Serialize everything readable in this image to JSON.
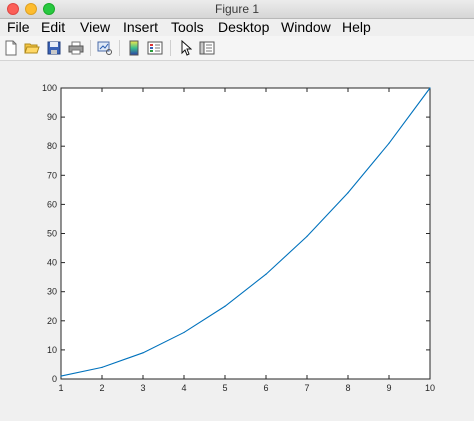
{
  "window": {
    "title": "Figure 1"
  },
  "menu": {
    "file": "File",
    "edit": "Edit",
    "view": "View",
    "insert": "Insert",
    "tools": "Tools",
    "desktop": "Desktop",
    "window": "Window",
    "help": "Help"
  },
  "toolbar": {
    "icons": [
      "new-figure-icon",
      "open-file-icon",
      "save-icon",
      "print-icon",
      "link-plot-icon",
      "colorbar-icon",
      "legend-icon",
      "edit-plot-arrow-icon",
      "property-inspector-icon"
    ]
  },
  "chart_data": {
    "type": "line",
    "x": [
      1,
      2,
      3,
      4,
      5,
      6,
      7,
      8,
      9,
      10
    ],
    "series": [
      {
        "values": [
          1,
          4,
          9,
          16,
          25,
          36,
          49,
          64,
          81,
          100
        ],
        "color": "#0072bd"
      }
    ],
    "xlim": [
      1,
      10
    ],
    "ylim": [
      0,
      100
    ],
    "xticks": [
      "1",
      "2",
      "3",
      "4",
      "5",
      "6",
      "7",
      "8",
      "9",
      "10"
    ],
    "yticks": [
      "0",
      "10",
      "20",
      "30",
      "40",
      "50",
      "60",
      "70",
      "80",
      "90",
      "100"
    ],
    "grid": false,
    "title": "",
    "xlabel": "",
    "ylabel": ""
  }
}
